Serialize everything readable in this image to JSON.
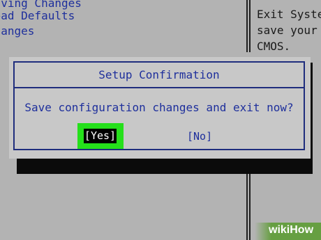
{
  "background_menu": {
    "lines": [
      "Saving Changes",
      "Load Defaults",
      "Changes",
      "es"
    ]
  },
  "help_panel": {
    "lines": [
      "Exit Syste",
      "save your",
      "CMOS."
    ]
  },
  "dialog": {
    "title": "Setup Confirmation",
    "message": "Save configuration changes and exit now?",
    "yes_label": "[Yes]",
    "no_label": "[No]"
  },
  "watermark": {
    "text": "wikiHow"
  },
  "colors": {
    "bios_text_blue": "#1e2f9c",
    "dialog_border": "#1f2d7d",
    "dialog_bg": "#c8c8c8",
    "bios_bg": "#b3b3b3",
    "highlight_green": "#25e01b",
    "selected_bg": "#000000",
    "selected_text": "#ffffff"
  }
}
